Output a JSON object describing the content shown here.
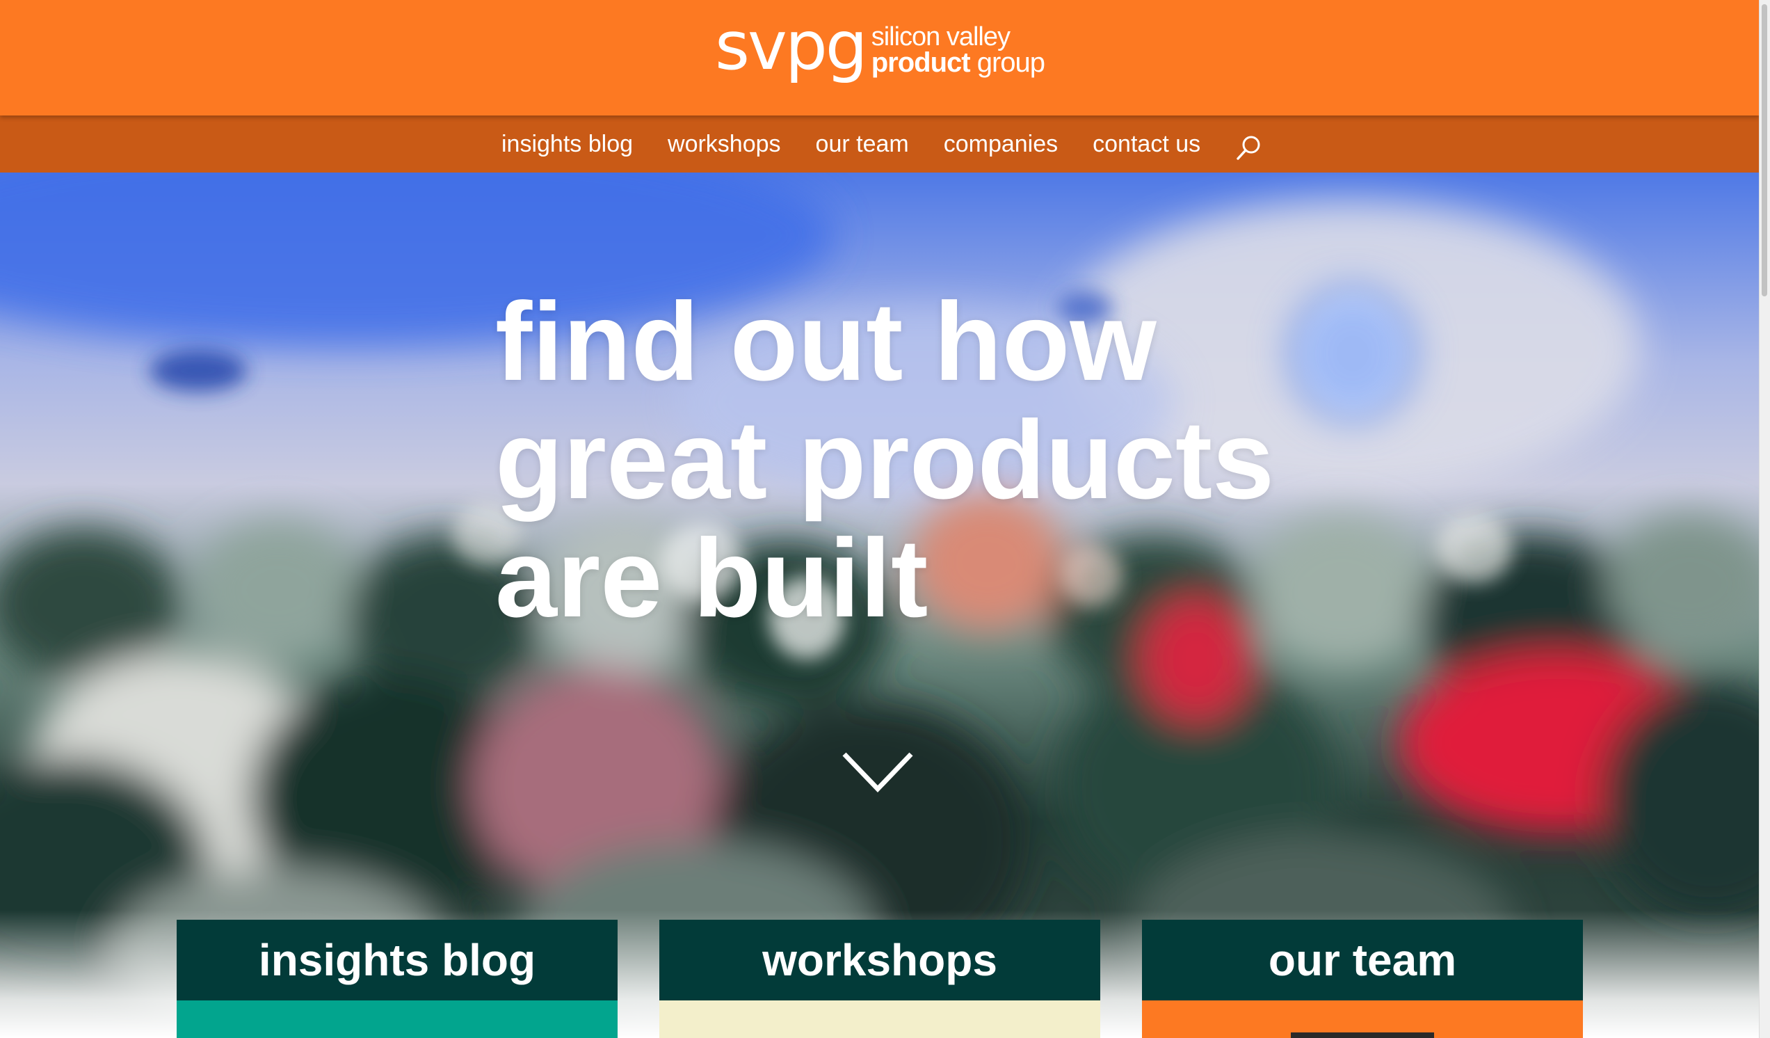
{
  "header": {
    "logo": {
      "mark": "svpg",
      "line1": "silicon valley",
      "line2_bold": "product",
      "line2_rest": " group"
    },
    "colors": {
      "accent": "#fd7922",
      "nav_bar": "#c95a16",
      "card_head": "#023b39"
    }
  },
  "nav": {
    "items": [
      {
        "label": "insights blog"
      },
      {
        "label": "workshops"
      },
      {
        "label": "our team"
      },
      {
        "label": "companies"
      },
      {
        "label": "contact us"
      }
    ],
    "search_icon": "search-icon"
  },
  "hero": {
    "line1": "find out how",
    "line2": "great products",
    "line3": "are built",
    "scroll_icon": "chevron-down-icon"
  },
  "cards": [
    {
      "title": "insights blog",
      "color": "#02a58e"
    },
    {
      "title": "workshops",
      "color": "#f3efcb"
    },
    {
      "title": "our team",
      "color": "#fd7922"
    }
  ]
}
